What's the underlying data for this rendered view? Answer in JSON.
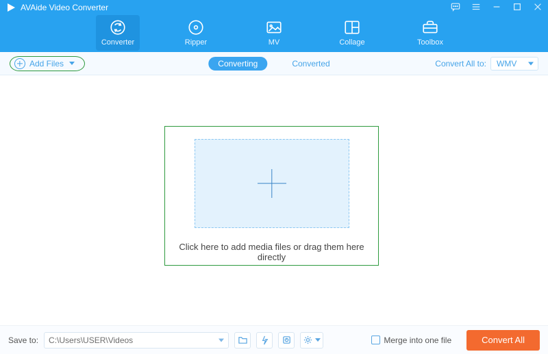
{
  "app": {
    "title": "AVAide Video Converter"
  },
  "main_tabs": [
    {
      "label": "Converter"
    },
    {
      "label": "Ripper"
    },
    {
      "label": "MV"
    },
    {
      "label": "Collage"
    },
    {
      "label": "Toolbox"
    }
  ],
  "subbar": {
    "add_files": "Add Files",
    "tab_converting": "Converting",
    "tab_converted": "Converted",
    "convert_all_to_label": "Convert All to:",
    "convert_all_to_value": "WMV"
  },
  "dropzone": {
    "text": "Click here to add media files or drag them here directly"
  },
  "bottom": {
    "save_to_label": "Save to:",
    "save_to_path": "C:\\Users\\USER\\Videos",
    "merge_label": "Merge into one file",
    "convert_button": "Convert All"
  }
}
